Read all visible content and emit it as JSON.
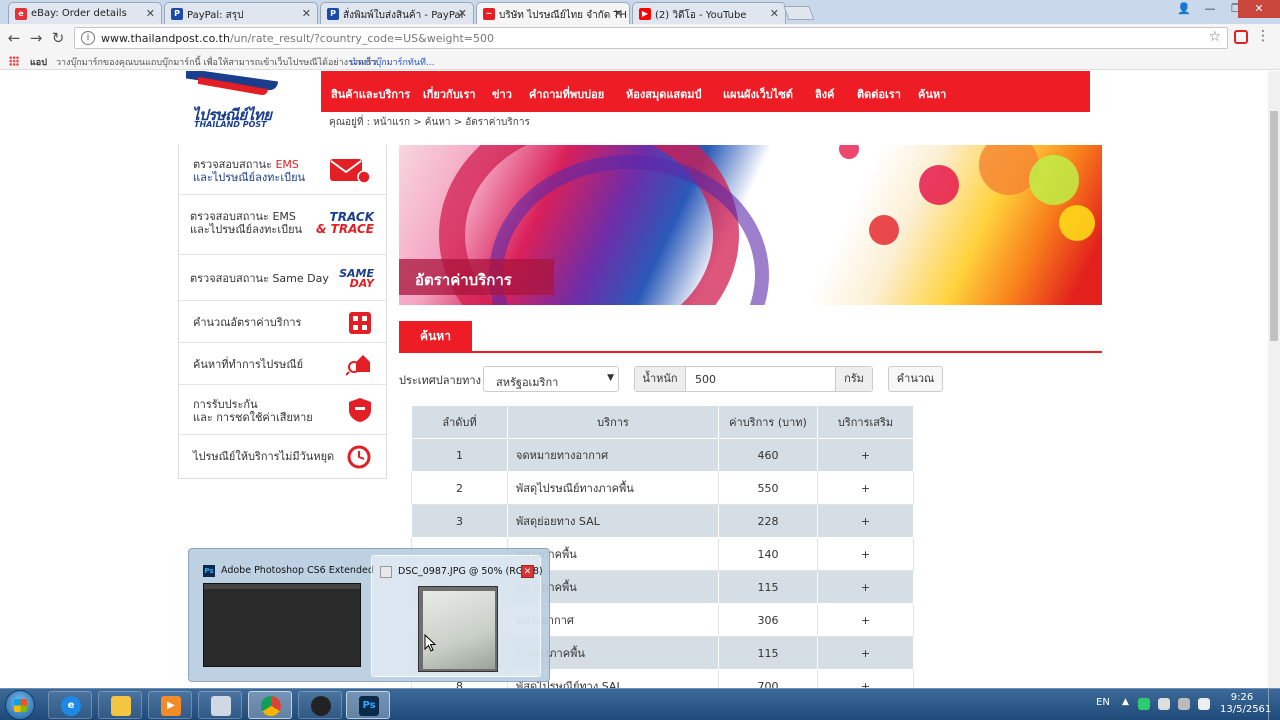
{
  "browser": {
    "tabs": [
      {
        "title": "eBay: Order details",
        "fav": "e",
        "fav_color": "#e53238"
      },
      {
        "title": "PayPal: สรุป",
        "fav": "P",
        "fav_color": "#1a4ba8"
      },
      {
        "title": "สั่งพิมพ์ใบส่งสินค้า - PayPal",
        "fav": "P",
        "fav_color": "#1a4ba8"
      },
      {
        "title": "บริษัท ไปรษณีย์ไทย จำกัด TH",
        "fav": "~",
        "fav_color": "#e31e24"
      },
      {
        "title": "(2) วิดีโอ - YouTube",
        "fav": "▶",
        "fav_color": "#ff0000"
      }
    ],
    "url_host": "www.thailandpost.co.th",
    "url_path": "/un/rate_result/?country_code=US&weight=500",
    "bookmarks": {
      "apps": "แอป",
      "hint": "วางบุ๊กมาร์กของคุณบนแถบบุ๊กมาร์กนี้ เพื่อให้สามารถเข้าเว็บไปรษณีได้อย่างรวดเร็ว",
      "link": "นำเข้าบุ๊กมาร์กทันที..."
    }
  },
  "site": {
    "logo_th": "ไปรษณีย์ไทย",
    "logo_en": "THAILAND POST",
    "nav": [
      "สินค้าและบริการ",
      "เกี่ยวกับเรา",
      "ข่าว",
      "คำถามที่พบบ่อย",
      "ห้องสมุดแสตมป์",
      "แผนผังเว็บไซต์",
      "ลิงค์",
      "ติดต่อเรา",
      "ค้นหา"
    ],
    "breadcrumb": "คุณอยู่ที่ : หน้าแรก > ค้นหา > อัตราค่าบริการ",
    "sidebar": {
      "item1_line1_a": "ตรวจสอบสถานะ ",
      "item1_line1_b": "EMS",
      "item1_line2_a": "และ",
      "item1_line2_b": "ไปรษณีย์ลงทะเบียน",
      "item2_line1": "ตรวจสอบสถานะ EMS",
      "item2_line2": "และไปรษณีย์ลงทะเบียน",
      "item2_logo_a": "TRACK",
      "item2_logo_b": "& TRACE",
      "item3": "ตรวจสอบสถานะ Same Day",
      "item3_logo_a": "SAME",
      "item3_logo_b": "DAY",
      "item4": "คำนวณอัตราค่าบริการ",
      "item5": "ค้นหาที่ทำการไปรษณีย์",
      "item6_line1": "การรับประกัน",
      "item6_line2": "และ การชดใช้ค่าเสียหาย",
      "item7": "ไปรษณีย์ให้บริการไม่มีวันหยุด"
    },
    "banner_title": "อัตราค่าบริการ",
    "search_tab": "ค้นหา",
    "form": {
      "country_label": "ประเทศปลายทาง",
      "country_value": "สหรัฐอเมริกา",
      "weight_label": "น้ำหนัก",
      "weight_value": "500",
      "unit": "กรัม",
      "calc_button": "คำนวณ"
    },
    "table": {
      "headers": [
        "ลำดับที่",
        "บริการ",
        "ค่าบริการ (บาท)",
        "บริการเสริม"
      ],
      "rows": [
        {
          "no": "1",
          "service": "จดหมายทางอากาศ",
          "price": "460",
          "extra": "+"
        },
        {
          "no": "2",
          "service": "พัสดุไปรษณีย์ทางภาคพื้น",
          "price": "550",
          "extra": "+"
        },
        {
          "no": "3",
          "service": "พัสดุย่อยทาง SAL",
          "price": "228",
          "extra": "+"
        },
        {
          "no": "",
          "service": "ยทางภาคพื้น",
          "price": "140",
          "extra": "+"
        },
        {
          "no": "",
          "service": "ยทางภาคพื้น",
          "price": "115",
          "extra": "+"
        },
        {
          "no": "",
          "service": "ยทางอากาศ",
          "price": "306",
          "extra": "+"
        },
        {
          "no": "",
          "service": "มพ์ทางภาคพื้น",
          "price": "115",
          "extra": "+"
        },
        {
          "no": "8",
          "service": "พัสดุไปรษณีย์ทาง SAL",
          "price": "700",
          "extra": "+"
        }
      ]
    }
  },
  "popup": {
    "thumb1_title": "Adobe Photoshop CS6 Extended",
    "thumb2_title": "DSC_0987.JPG @ 50% (RGB/8)",
    "ps_badge": "Ps"
  },
  "taskbar": {
    "lang": "EN",
    "time": "9:26",
    "date": "13/5/2561",
    "ps_label": "Ps"
  }
}
